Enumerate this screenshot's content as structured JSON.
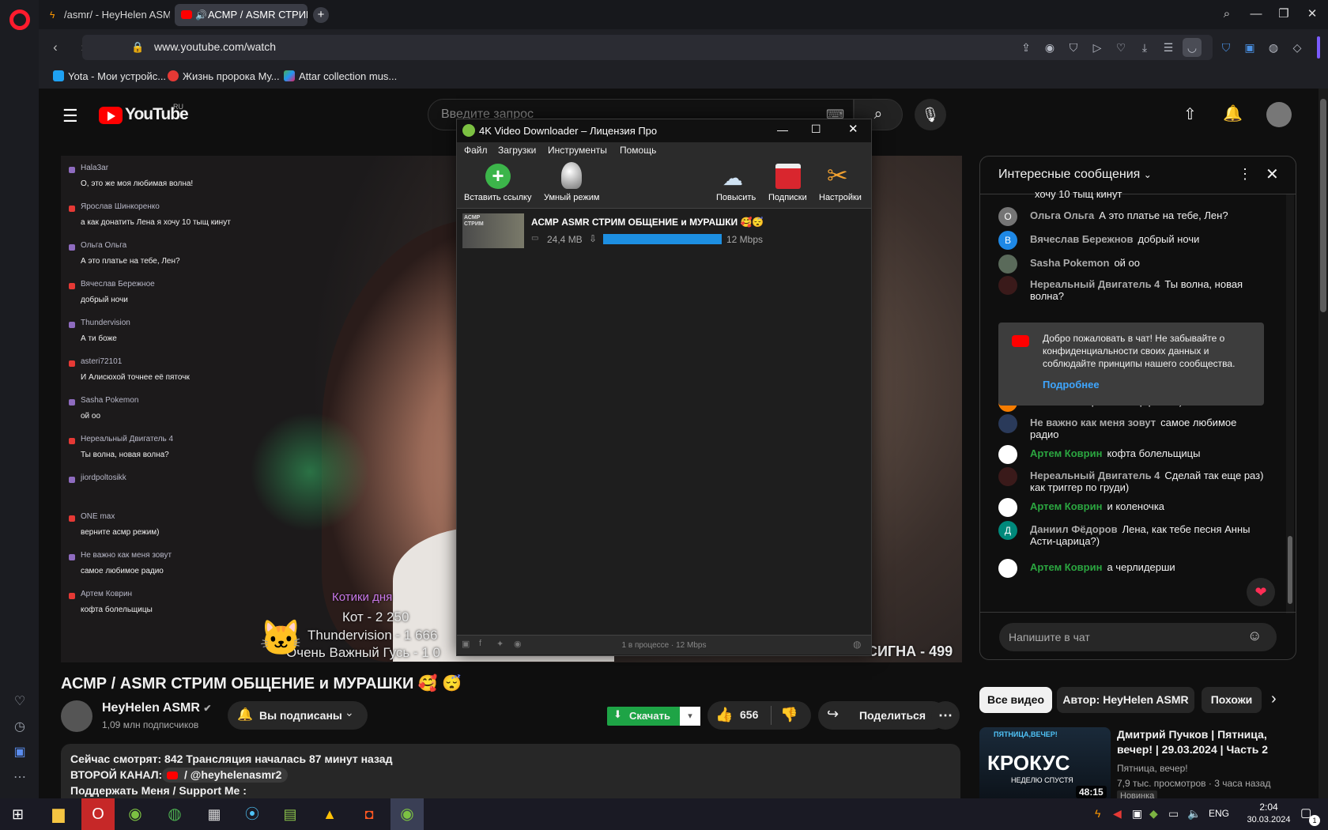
{
  "browser": {
    "tabs": [
      {
        "label": "/asmr/ - HeyHelen ASMR"
      },
      {
        "label": "АСМР / ASMR СТРИМ"
      }
    ],
    "url": "www.youtube.com/watch",
    "bookmarks": [
      {
        "label": "Yota - Мои устройс..."
      },
      {
        "label": "Жизнь пророка Му..."
      },
      {
        "label": "Attar collection mus..."
      }
    ]
  },
  "youtube": {
    "logo_text": "YouTube",
    "region": "RU",
    "search_placeholder": "Введите запрос",
    "video_title": "АСМР / ASMR СТРИМ ОБЩЕНИЕ и МУРАШКИ 🥰 😴",
    "channel": {
      "name": "HeyHelen ASMR",
      "subscribers": "1,09 млн подписчиков",
      "subscribe_label": "Вы подписаны"
    },
    "actions": {
      "download": "Скачать",
      "likes": "656",
      "share": "Поделиться"
    },
    "description": [
      "Сейчас смотрят: 842  Трансляция началась 87 минут назад",
      "ВТОРОЙ КАНАЛ:",
      "/ @heyhelenasmr2",
      "Поддержать Меня / Support Me :"
    ],
    "video_overlay": {
      "chat": [
        {
          "name": "Hala3ar",
          "msg": "О, это же моя любимая волна!"
        },
        {
          "name": "Ярослав Шинкоренко",
          "msg": "а как донатить Лена я хочу 10 тыщ кинут"
        },
        {
          "name": "Ольга Ольга",
          "msg": "А это платье на тебе, Лен?"
        },
        {
          "name": "Вячеслав Бережное",
          "msg": "добрый ночи"
        },
        {
          "name": "Thundervision",
          "msg": "А ти боже"
        },
        {
          "name": "asteri72101",
          "msg": "И Алисюхой точнее её пяточк"
        },
        {
          "name": "Sasha Pokemon",
          "msg": "ой оо"
        },
        {
          "name": "Нереальный Двигатель 4",
          "msg": "Ты волна, новая волна?"
        },
        {
          "name": "jiordpoltosikk",
          "msg": ""
        },
        {
          "name": "ONE max",
          "msg": "верните асмр режим)"
        },
        {
          "name": "Не важно как меня зовут",
          "msg": "самое любимое радио"
        },
        {
          "name": "Артем Коврин",
          "msg": "кофта болельщицы"
        }
      ],
      "leaderboard_title": "Котики дня",
      "leaderboard": [
        "Кот - 2 250",
        "Thundervision - 1 666",
        "Очень Важный Гусь - 1 0"
      ],
      "right_text": "СИГНА - 499"
    },
    "live_chat": {
      "title": "Интересные сообщения",
      "messages": [
        {
          "author": "",
          "text": "хочу 10 тыщ кинут",
          "avatar": "",
          "color": "#3ea6ff"
        },
        {
          "author": "Ольга Ольга",
          "text": "А это платье на тебе, Лен?",
          "avatar": "О",
          "color": "#757575"
        },
        {
          "author": "Вячеслав Бережнов",
          "text": "добрый ночи",
          "avatar": "В",
          "color": "#1e88e5"
        },
        {
          "author": "Sasha Pokemon",
          "text": "ой оо",
          "avatar": "",
          "color": "#5a6a5a"
        },
        {
          "author": "Нереальный Двигатель 4",
          "text": "Ты волна, новая",
          "text2": "волна?",
          "avatar": "",
          "color": "#3a1a1a"
        },
        {
          "author": "ONE max",
          "text": "верните асмр режим)",
          "avatar": "O",
          "color": "#f57c00"
        },
        {
          "author": "Не важно как меня зовут",
          "text": "самое любимое",
          "text2": "радио",
          "avatar": "",
          "color": "#2a3a5a"
        },
        {
          "author": "Артем Коврин",
          "text": "кофта болельщицы",
          "avatar": "",
          "color": "#ffffff",
          "green": true
        },
        {
          "author": "Нереальный Двигатель 4",
          "text": "Сделай так еще раз)",
          "text2": "как триггер по груди)",
          "avatar": "",
          "color": "#3a1a1a"
        },
        {
          "author": "Артем Коврин",
          "text": "и коленочка",
          "avatar": "",
          "color": "#ffffff",
          "green": true
        },
        {
          "author": "Даниил Фёдоров",
          "text": "Лена, как тебе песня Анны",
          "text2": "Асти-царица?)",
          "avatar": "Д",
          "color": "#00897b"
        },
        {
          "author": "Артем Коврин",
          "text": "а черлидерши",
          "avatar": "",
          "color": "#ffffff",
          "green": true
        }
      ],
      "welcome": {
        "text": [
          "Добро пожаловать в чат! Не забывайте о",
          "конфиденциальности своих данных и",
          "соблюдайте принципы нашего сообщества."
        ],
        "link": "Подробнее"
      },
      "input_placeholder": "Напишите в чат"
    },
    "chips": [
      "Все видео",
      "Автор: HeyHelen ASMR",
      "Похожи"
    ],
    "recommendation": {
      "title": "Дмитрий Пучков | Пятница, вечер! | 29.03.2024 | Часть 2",
      "channel": "Пятница, вечер!",
      "meta": "7,9 тыс. просмотров · 3 часа назад",
      "badge": "Новинка",
      "duration": "48:15",
      "thumb_text": "КРОКУС",
      "thumb_sub": "НЕДЕЛЮ СПУСТЯ",
      "thumb_top": "ПЯТНИЦА,ВЕЧЕР!"
    }
  },
  "downloader": {
    "title": "4K Video Downloader – Лицензия Про",
    "menu": [
      "Файл",
      "Загрузки",
      "Инструменты",
      "Помощь"
    ],
    "tools": [
      "Вставить ссылку",
      "Умный режим",
      "Повысить",
      "Подписки",
      "Настройки"
    ],
    "item": {
      "title": "АСМР  ASMR СТРИМ ОБЩЕНИЕ и МУРАШКИ 🥰😴",
      "size": "24,4 MB",
      "speed": "12 Mbps",
      "progress": 1.0,
      "thumb_text": "АСМР СТРИМ"
    },
    "status": "1 в процессе · 12 Mbps"
  },
  "taskbar": {
    "lang": "ENG",
    "time": "2:04",
    "date": "30.03.2024",
    "badge": "1"
  }
}
